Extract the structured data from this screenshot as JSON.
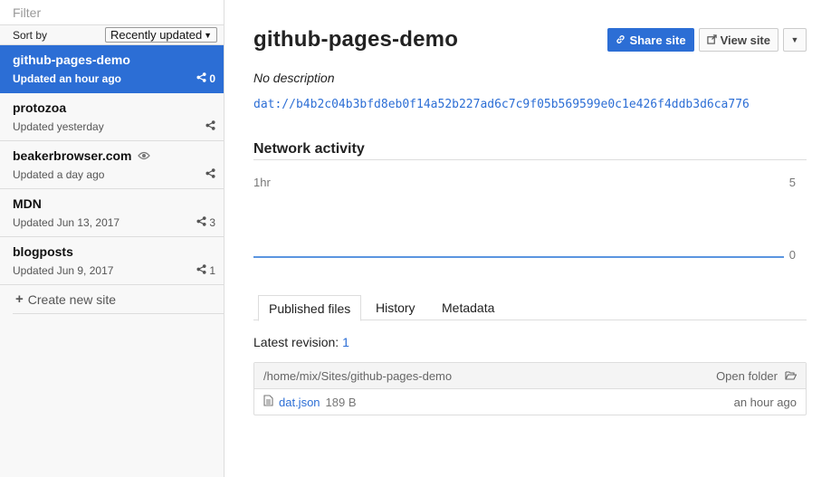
{
  "sidebar": {
    "filter_placeholder": "Filter",
    "sort_label": "Sort by",
    "sort_value": "Recently updated",
    "sites": [
      {
        "title": "github-pages-demo",
        "updated": "Updated an hour ago",
        "peers": "0",
        "active": true
      },
      {
        "title": "protozoa",
        "updated": "Updated yesterday",
        "peers": ""
      },
      {
        "title": "beakerbrowser.com",
        "updated": "Updated a day ago",
        "peers": "",
        "icon": "eye-icon"
      },
      {
        "title": "MDN",
        "updated": "Updated Jun 13, 2017",
        "peers": "3"
      },
      {
        "title": "blogposts",
        "updated": "Updated Jun 9, 2017",
        "peers": "1"
      }
    ],
    "create_label": "Create new site"
  },
  "main": {
    "title": "github-pages-demo",
    "share_label": "Share site",
    "view_label": "View site",
    "description": "No description",
    "dat_url": "dat://b4b2c04b3bfd8eb0f14a52b227ad6c7c9f05b569599e0c1e426f4ddb3d6ca776",
    "network_heading": "Network activity",
    "chart": {
      "left_label": "1hr",
      "top_label": "5",
      "bottom_label": "0"
    },
    "tabs": [
      "Published files",
      "History",
      "Metadata"
    ],
    "latest_label": "Latest revision:",
    "latest_value": "1",
    "files": {
      "path": "/home/mix/Sites/github-pages-demo",
      "open_folder_label": "Open folder",
      "rows": [
        {
          "name": "dat.json",
          "size": "189 B",
          "time": "an hour ago"
        }
      ]
    }
  },
  "colors": {
    "accent": "#2c6ed5",
    "sidebar_bg": "#f8f8f8",
    "chart_line": "#5b95e0"
  }
}
